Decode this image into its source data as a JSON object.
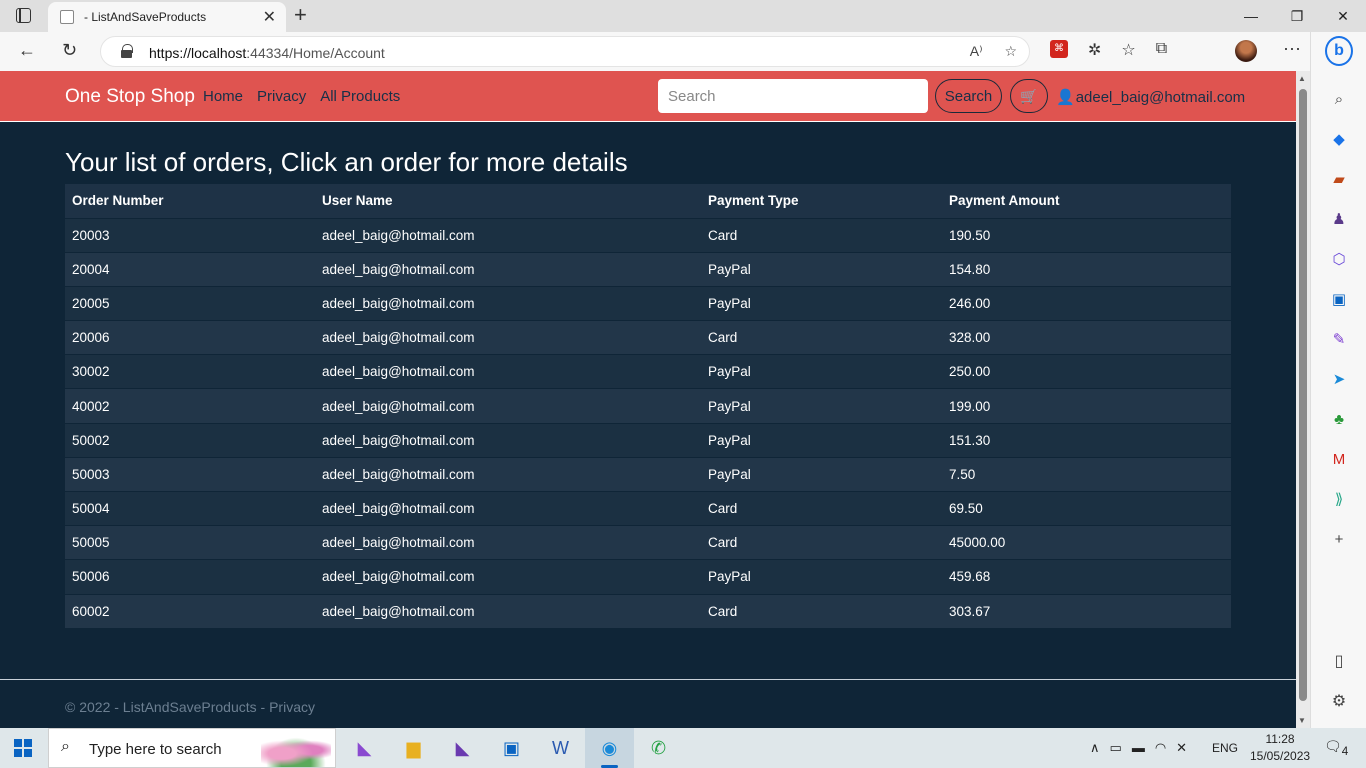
{
  "browser": {
    "tab_title": "- ListAndSaveProducts",
    "url_host": "https://localhost",
    "url_rest": ":44334/Home/Account"
  },
  "site": {
    "brand": "One Stop Shop",
    "nav": [
      "Home",
      "Privacy",
      "All Products"
    ],
    "search_placeholder": "Search",
    "search_button": "Search",
    "user_email": "adeel_baig@hotmail.com"
  },
  "page": {
    "title": "Your list of orders, Click an order for more details",
    "headers": [
      "Order Number",
      "User Name",
      "Payment Type",
      "Payment Amount"
    ],
    "rows": [
      [
        "20003",
        "adeel_baig@hotmail.com",
        "Card",
        "190.50"
      ],
      [
        "20004",
        "adeel_baig@hotmail.com",
        "PayPal",
        "154.80"
      ],
      [
        "20005",
        "adeel_baig@hotmail.com",
        "PayPal",
        "246.00"
      ],
      [
        "20006",
        "adeel_baig@hotmail.com",
        "Card",
        "328.00"
      ],
      [
        "30002",
        "adeel_baig@hotmail.com",
        "PayPal",
        "250.00"
      ],
      [
        "40002",
        "adeel_baig@hotmail.com",
        "PayPal",
        "199.00"
      ],
      [
        "50002",
        "adeel_baig@hotmail.com",
        "PayPal",
        "151.30"
      ],
      [
        "50003",
        "adeel_baig@hotmail.com",
        "PayPal",
        "7.50"
      ],
      [
        "50004",
        "adeel_baig@hotmail.com",
        "Card",
        "69.50"
      ],
      [
        "50005",
        "adeel_baig@hotmail.com",
        "Card",
        "45000.00"
      ],
      [
        "50006",
        "adeel_baig@hotmail.com",
        "PayPal",
        "459.68"
      ],
      [
        "60002",
        "adeel_baig@hotmail.com",
        "Card",
        "303.67"
      ]
    ]
  },
  "footer": {
    "copyright": "© 2022 - ListAndSaveProducts - ",
    "privacy": "Privacy"
  },
  "taskbar": {
    "search_text": "Type here to search",
    "lang": "ENG",
    "time": "11:28",
    "date": "15/05/2023",
    "notifications": "4"
  },
  "colors": {
    "navbar": "#df5450",
    "page_bg": "#0f2537",
    "table_row": "#1b3042"
  }
}
